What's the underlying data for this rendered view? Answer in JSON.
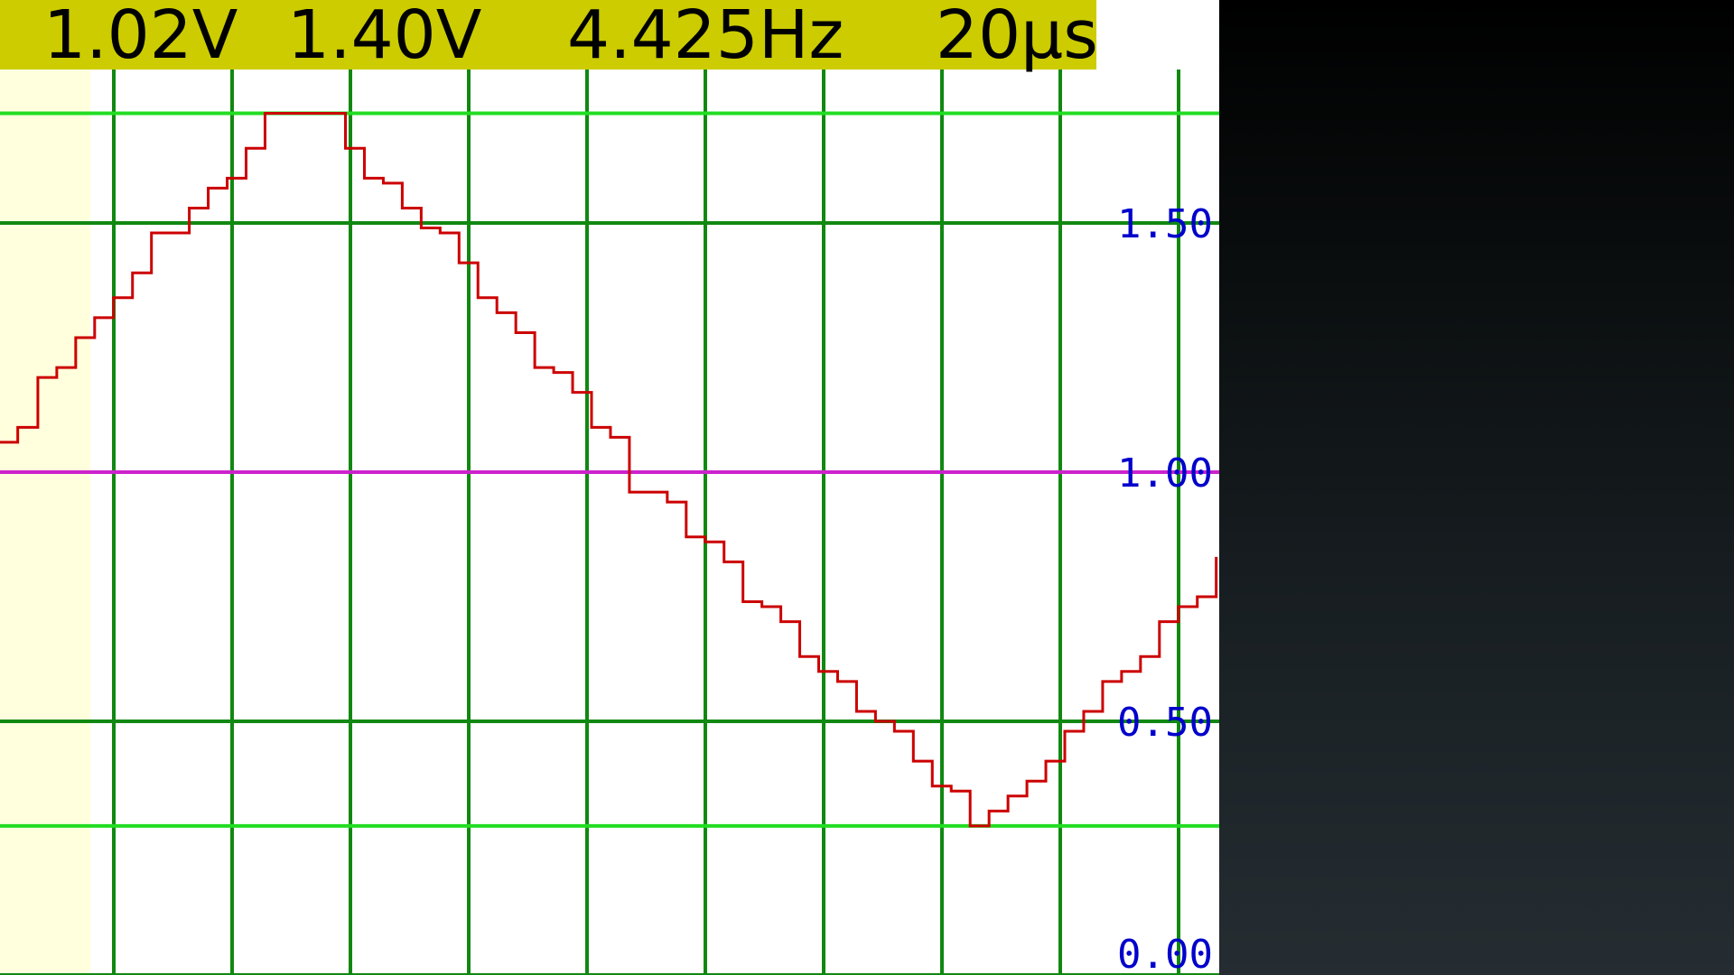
{
  "readout": {
    "voltage_1": "1.02V",
    "voltage_2": "1.40V",
    "frequency": "4.425Hz",
    "timebase": "20µs"
  },
  "colors": {
    "readout_bar": "#cccc00",
    "pretrigger_shade": "#ffffdd",
    "grid_major": "#118811",
    "grid_cursor": "#22dd22",
    "trace": "#cc0000",
    "trigger_level": "#cc22cc",
    "tick_label": "#0000cc"
  },
  "chart_data": {
    "type": "line",
    "y_tick_labels": [
      "1.50",
      "1.00",
      "0.50",
      "0.00"
    ],
    "y_ticks": [
      1.5,
      1.0,
      0.5,
      0.0
    ],
    "ylim": [
      0.0,
      1.95
    ],
    "xlim": [
      0,
      10.3
    ],
    "grid": true,
    "vertical_gridlines_at_div": [
      1,
      2,
      3,
      4,
      5,
      6,
      7,
      8,
      9,
      10
    ],
    "horizontal_gridlines_at": [
      0.0,
      0.5,
      1.0,
      1.5
    ],
    "cursor_levels": [
      1.02,
      1.4
    ],
    "cursor_levels_plotted": [
      0.29,
      1.72
    ],
    "trigger_level": 1.0,
    "series": [
      {
        "style": "stepped",
        "x": [
          0.0,
          0.15,
          0.32,
          0.48,
          0.64,
          0.8,
          0.96,
          1.12,
          1.28,
          1.44,
          1.6,
          1.76,
          1.92,
          2.08,
          2.24,
          2.4,
          2.92,
          3.08,
          3.24,
          3.4,
          3.56,
          3.72,
          3.88,
          4.04,
          4.2,
          4.36,
          4.52,
          4.68,
          4.84,
          5.0,
          5.16,
          5.32,
          5.48,
          5.64,
          5.8,
          5.96,
          6.12,
          6.28,
          6.44,
          6.6,
          6.76,
          6.92,
          7.08,
          7.24,
          7.4,
          7.56,
          7.72,
          7.88,
          8.04,
          8.2,
          8.36,
          8.52,
          8.68,
          8.84,
          9.0,
          9.16,
          9.32,
          9.48,
          9.64,
          9.8,
          9.96,
          10.12,
          10.28
        ],
        "y": [
          1.06,
          1.09,
          1.19,
          1.21,
          1.27,
          1.31,
          1.35,
          1.4,
          1.48,
          1.48,
          1.53,
          1.57,
          1.59,
          1.65,
          1.72,
          1.72,
          1.65,
          1.59,
          1.58,
          1.53,
          1.49,
          1.48,
          1.42,
          1.35,
          1.32,
          1.28,
          1.21,
          1.2,
          1.16,
          1.09,
          1.07,
          0.96,
          0.96,
          0.94,
          0.87,
          0.86,
          0.82,
          0.74,
          0.73,
          0.7,
          0.63,
          0.6,
          0.58,
          0.52,
          0.5,
          0.48,
          0.42,
          0.37,
          0.36,
          0.29,
          0.32,
          0.35,
          0.38,
          0.42,
          0.48,
          0.52,
          0.58,
          0.6,
          0.63,
          0.7,
          0.73,
          0.75,
          0.83
        ]
      }
    ]
  }
}
